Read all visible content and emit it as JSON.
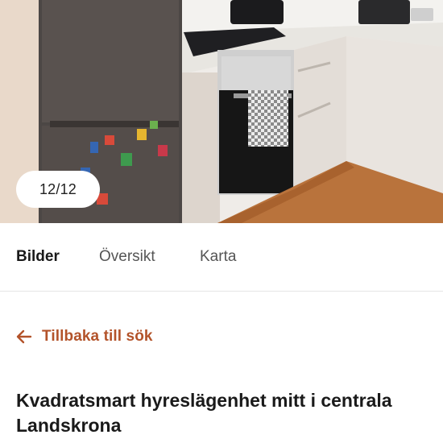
{
  "gallery": {
    "counter": "12/12"
  },
  "tabs": [
    {
      "label": "Bilder",
      "active": true
    },
    {
      "label": "Översikt",
      "active": false
    },
    {
      "label": "Karta",
      "active": false
    }
  ],
  "back_link": {
    "label": "Tillbaka till sök",
    "icon": "arrow-left-icon",
    "color": "#b3532a"
  },
  "listing": {
    "title": "Kvadratsmart hyreslägenhet mitt i centrala Landskrona"
  }
}
